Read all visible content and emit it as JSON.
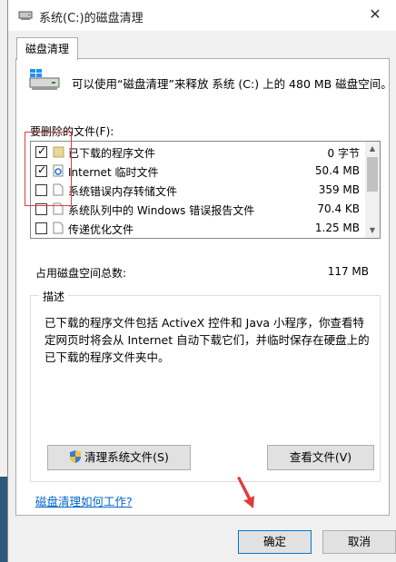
{
  "window": {
    "title": "系统(C:)的磁盘清理",
    "close_glyph": "✕"
  },
  "tab": {
    "label": "磁盘清理"
  },
  "intro": {
    "text": "可以使用“磁盘清理”来释放 系统 (C:) 上的 480 MB 磁盘空间。"
  },
  "files": {
    "label": "要删除的文件(F):",
    "items": [
      {
        "checked": true,
        "icon": "folder-icon",
        "name": "已下载的程序文件",
        "size": "0 字节"
      },
      {
        "checked": true,
        "icon": "ie-file-icon",
        "name": "Internet 临时文件",
        "size": "50.4 MB"
      },
      {
        "checked": false,
        "icon": "file-icon",
        "name": "系统错误内存转储文件",
        "size": "359 MB"
      },
      {
        "checked": false,
        "icon": "file-icon",
        "name": "系统队列中的 Windows 错误报告文件",
        "size": "70.4 KB"
      },
      {
        "checked": false,
        "icon": "file-icon",
        "name": "传递优化文件",
        "size": "1.25 MB"
      }
    ],
    "check_glyph": "✓"
  },
  "total": {
    "label": "占用磁盘空间总数:",
    "value": "117 MB"
  },
  "description": {
    "title": "描述",
    "text": "已下载的程序文件包括 ActiveX 控件和 Java 小程序，你查看特定网页时将会从 Internet 自动下载它们，并临时保存在硬盘上的已下载的程序文件夹中。"
  },
  "buttons": {
    "clean_system": "清理系统文件(S)",
    "view_files": "查看文件(V)",
    "ok": "确定",
    "cancel": "取消"
  },
  "help_link": "磁盘清理如何工作?",
  "colors": {
    "accent": "#0078d7",
    "highlight": "#e23b3b",
    "link": "#0066cc"
  }
}
